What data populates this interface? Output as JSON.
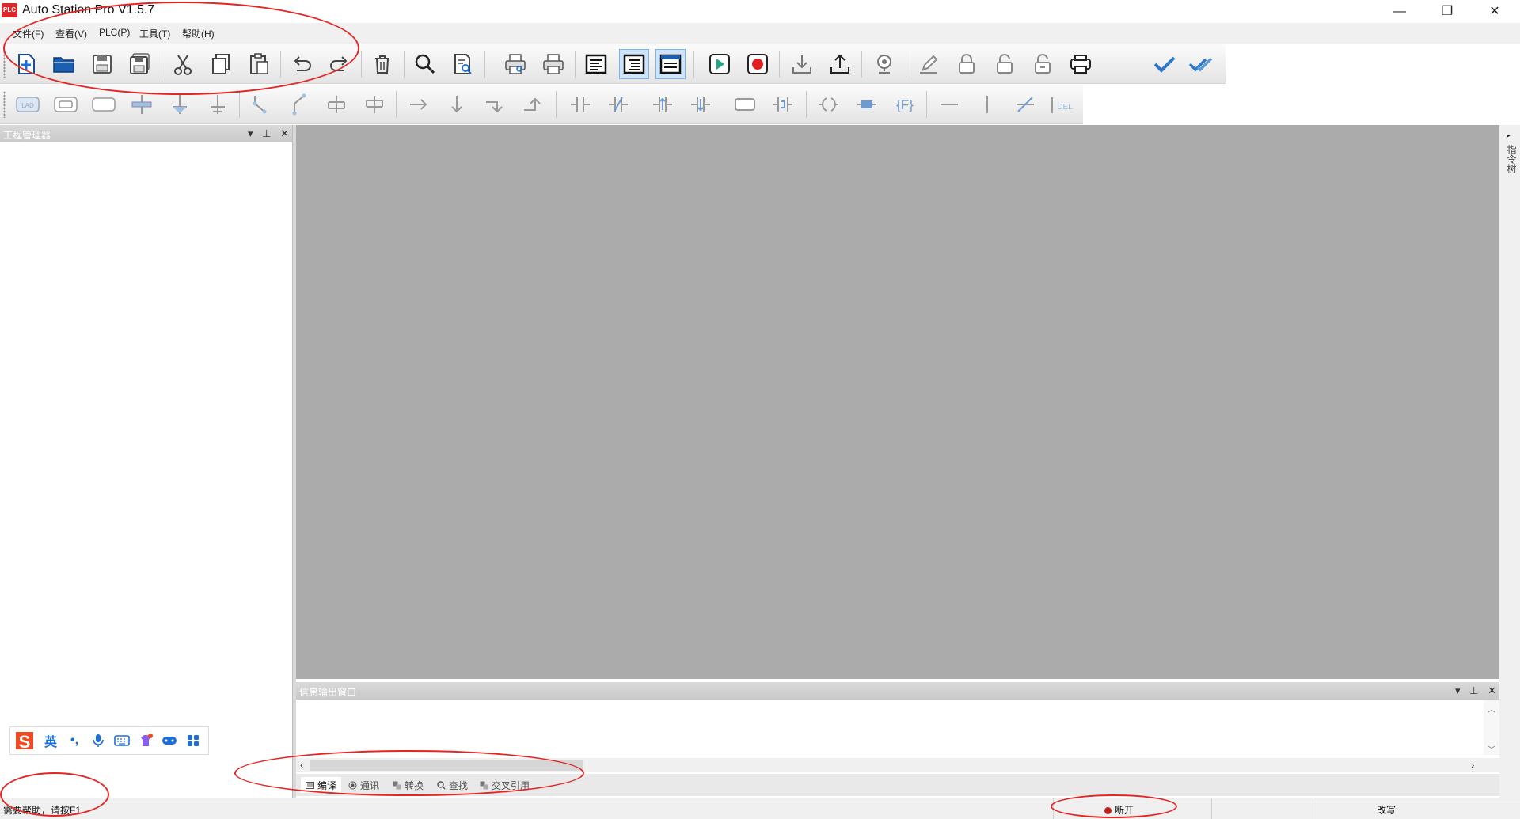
{
  "window": {
    "title": "Auto Station Pro V1.5.7",
    "logo_text": "PLC",
    "minimize_glyph": "—",
    "restore_glyph": "❐",
    "close_glyph": "✕"
  },
  "menubar": {
    "items": [
      {
        "label": "文件(F)"
      },
      {
        "label": "查看(V)"
      },
      {
        "label": "PLC(P)"
      },
      {
        "label": "工具(T)"
      },
      {
        "label": "帮助(H)"
      }
    ]
  },
  "toolbar_main": {
    "buttons": [
      "new-file-icon",
      "open-folder-icon",
      "save-icon",
      "save-all-icon",
      "cut-icon",
      "copy-icon",
      "paste-icon",
      "undo-icon",
      "redo-icon",
      "delete-icon",
      "find-icon",
      "find-in-file-icon",
      "print-preview-icon",
      "print-icon",
      "view-ladder-icon",
      "view-instruction-icon",
      "view-comment-icon",
      "run-icon",
      "stop-icon",
      "download-icon",
      "upload-icon",
      "monitor-icon",
      "edit-icon",
      "lock-icon",
      "unlock-icon",
      "unlock-all-icon",
      "printer-icon",
      "compile-icon",
      "compile-all-icon"
    ],
    "active": [
      "view-instruction-icon",
      "view-comment-icon"
    ]
  },
  "toolbar_ladder": {
    "buttons": [
      "lad-icon",
      "block-icon",
      "box-icon",
      "insert-row-icon",
      "insert-below-icon",
      "insert-below-2-icon",
      "branch-left-icon",
      "branch-right-icon",
      "parallel-icon",
      "parallel-2-icon",
      "arrow-right-icon",
      "arrow-down-icon",
      "line-end-icon",
      "line-up-icon",
      "contact-no-icon",
      "contact-nc-icon",
      "contact-rising-icon",
      "contact-falling-icon",
      "instruction-box-icon",
      "inverse-icon",
      "coil-icon",
      "function-block-icon",
      "function-icon",
      "horizontal-line-icon",
      "vertical-line-icon",
      "slash-line-icon",
      "delete-line-icon"
    ],
    "del_label": "DEL",
    "lad_label": "LAD",
    "func_label": "{F}"
  },
  "project_panel": {
    "title": "工程管理器",
    "dropdown_glyph": "▾",
    "pin_glyph": "⊥",
    "close_glyph": "✕"
  },
  "right_strip": {
    "arrow": "▸",
    "label": "指令树"
  },
  "output_panel": {
    "title": "信息输出窗口",
    "tabs": [
      {
        "label": "编译",
        "active": true
      },
      {
        "label": "通讯",
        "active": false
      },
      {
        "label": "转换",
        "active": false
      },
      {
        "label": "查找",
        "active": false
      },
      {
        "label": "交叉引用",
        "active": false
      }
    ]
  },
  "ime": {
    "lang": "英",
    "punct": "•,"
  },
  "statusbar": {
    "help_text": "需要帮助，请按F1",
    "connection": "断开",
    "mode": "改写"
  },
  "colors": {
    "annotation": "#e52424",
    "editor_bg": "#ababab",
    "accent_blue": "#1a6fd8",
    "status_red": "#c31d1d"
  }
}
